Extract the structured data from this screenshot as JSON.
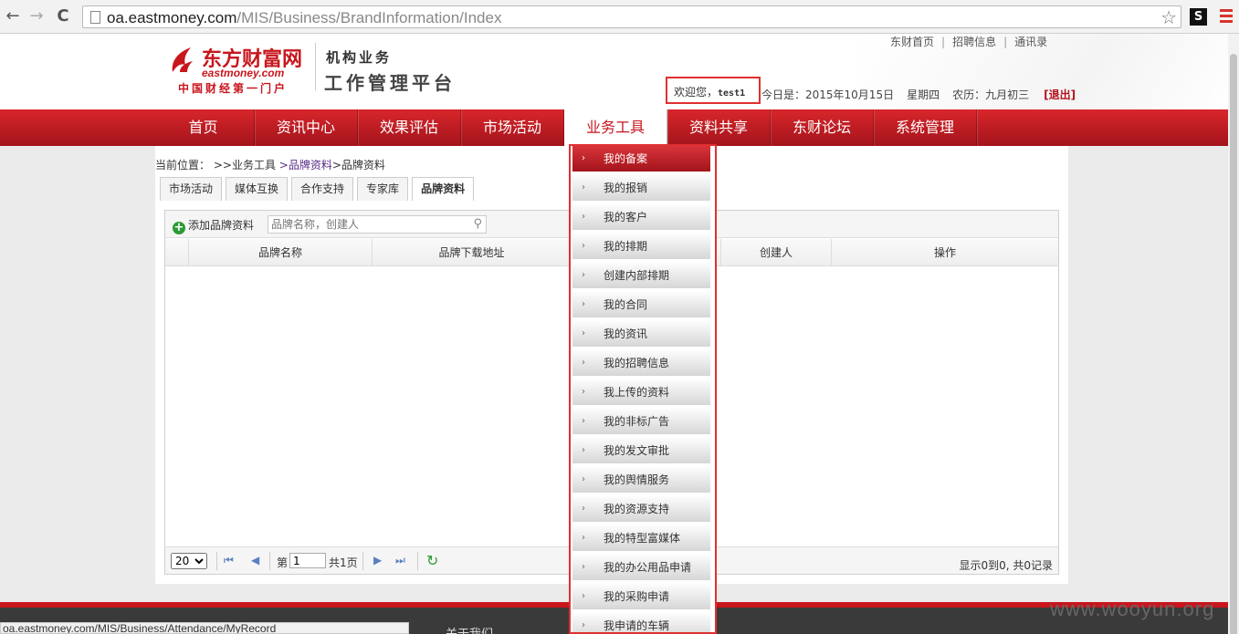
{
  "browser": {
    "url_host": "oa.eastmoney.com",
    "url_path": "/MIS/Business/BrandInformation/Index",
    "back_icon": "←",
    "forward_icon": "→",
    "reload_icon": "C",
    "star_icon": "☆",
    "extension_label": "S"
  },
  "header": {
    "logo_cn": "东方财富网",
    "logo_en": "eastmoney.com",
    "logo_tag": "中国财经第一门户",
    "brand_sub1": "机构业务",
    "brand_sub2": "工作管理平台",
    "top_links": [
      "东财首页",
      "招聘信息",
      "通讯录"
    ],
    "welcome": "欢迎您，",
    "username": "test1",
    "date_label": "今日是：2015年10月15日",
    "weekday": "星期四",
    "lunar": "农历：九月初三",
    "logout": "[退出]"
  },
  "main_nav": {
    "items": [
      "首页",
      "资讯中心",
      "效果评估",
      "市场活动",
      "业务工具",
      "资料共享",
      "东财论坛",
      "系统管理"
    ],
    "active_index": 4
  },
  "breadcrumb": {
    "prefix": "当前位置：",
    "part1": ">>业务工具",
    "part2": ">品牌资料",
    "part3": ">品牌资料"
  },
  "tabs": {
    "items": [
      "市场活动",
      "媒体互换",
      "合作支持",
      "专家库",
      "品牌资料"
    ],
    "active_index": 4
  },
  "toolbar": {
    "add_label": "添加品牌资料",
    "search_placeholder": "品牌名称，创建人"
  },
  "grid": {
    "columns": [
      "品牌名称",
      "品牌下载地址",
      "创建人",
      "操作"
    ],
    "rows": []
  },
  "pager": {
    "page_size": "20",
    "page_prefix": "第",
    "current_page": "1",
    "page_suffix": "共1页",
    "record_info": "显示0到0, 共0记录"
  },
  "dropdown": {
    "items": [
      "我的备案",
      "我的报销",
      "我的客户",
      "我的排期",
      "创建内部排期",
      "我的合同",
      "我的资讯",
      "我的招聘信息",
      "我上传的资料",
      "我的非标广告",
      "我的发文审批",
      "我的舆情服务",
      "我的资源支持",
      "我的特型富媒体",
      "我的办公用品申请",
      "我的采购申请",
      "我申请的车辆"
    ],
    "active_index": 0
  },
  "footer": {
    "about": "关于我们",
    "status_url": "oa.eastmoney.com/MIS/Business/Attendance/MyRecord",
    "watermark": "www.wooyun.org"
  },
  "colors": {
    "brand_red": "#c8161d",
    "highlight_box": "#e03030"
  }
}
